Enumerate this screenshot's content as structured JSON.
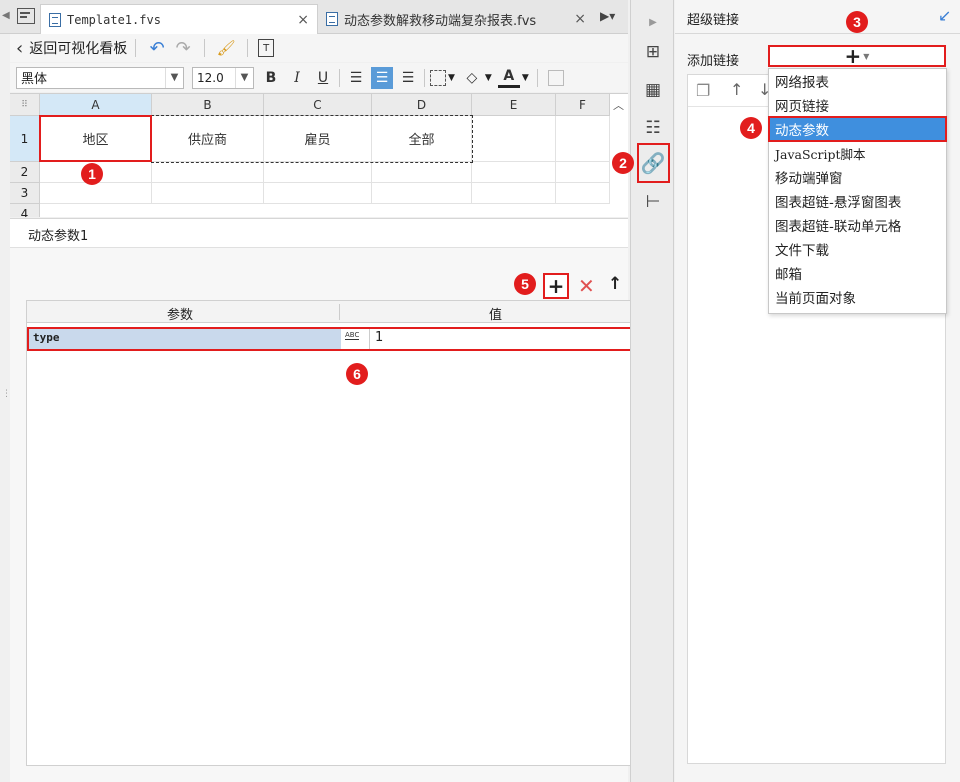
{
  "tabs": [
    {
      "label": "Template1.fvs",
      "close": "×"
    },
    {
      "label": "动态参数解救移动端复杂报表.fvs",
      "close": "×"
    }
  ],
  "toolbar": {
    "back_label": "返回可视化看板",
    "font": "黑体",
    "font_size": "12.0",
    "bold": "B",
    "italic": "I",
    "underline": "U",
    "font_color_glyph": "A"
  },
  "grid": {
    "columns": [
      "A",
      "B",
      "C",
      "D",
      "E",
      "F"
    ],
    "rows": [
      "1",
      "2",
      "3",
      "4"
    ],
    "row1": [
      "地区",
      "供应商",
      "雇员",
      "全部"
    ]
  },
  "bottom": {
    "title": "动态参数1",
    "table_headers": [
      "参数",
      "值"
    ],
    "param_row": {
      "name": "type",
      "type_glyph": "ABC",
      "value": "1"
    }
  },
  "right_panel": {
    "title": "超级链接",
    "add_label": "添加链接",
    "add_glyph": "+",
    "menu": [
      "网络报表",
      "网页链接",
      "动态参数",
      "JavaScript脚本",
      "移动端弹窗",
      "图表超链-悬浮窗图表",
      "图表超链-联动单元格",
      "文件下载",
      "邮箱",
      "当前页面对象"
    ],
    "selected_index": 2
  },
  "badges": [
    "1",
    "2",
    "3",
    "4",
    "5",
    "6"
  ],
  "colors": {
    "highlight": "#3f8fde",
    "annotation": "#e21d1d",
    "link_icon": "#3a7fd5"
  }
}
